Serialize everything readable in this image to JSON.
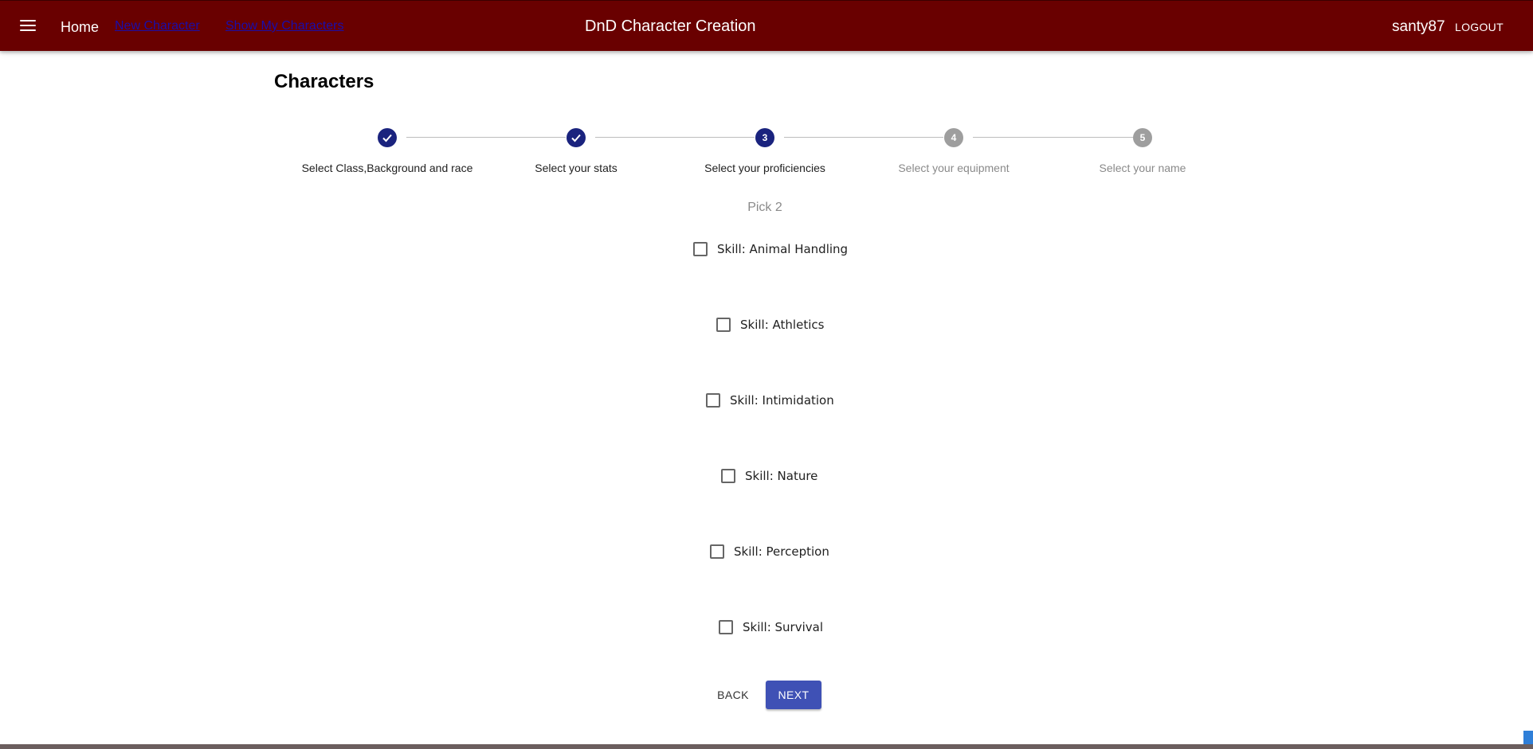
{
  "appbar": {
    "home_label": "Home",
    "new_character_label": "New Character",
    "show_characters_label": "Show My Characters",
    "title": "DnD Character Creation",
    "username": "santy87",
    "logout_label": "LOGOUT",
    "color": "#690000"
  },
  "page": {
    "title": "Characters"
  },
  "stepper": {
    "steps": [
      {
        "number": "1",
        "label": "Select Class,Background and race",
        "state": "done"
      },
      {
        "number": "2",
        "label": "Select your stats",
        "state": "done"
      },
      {
        "number": "3",
        "label": "Select your proficiencies",
        "state": "active"
      },
      {
        "number": "4",
        "label": "Select your equipment",
        "state": "pending"
      },
      {
        "number": "5",
        "label": "Select your name",
        "state": "pending"
      }
    ],
    "active_color": "#1a237e",
    "pending_color": "#9e9e9e"
  },
  "proficiencies": {
    "pick_label": "Pick 2",
    "skills": [
      {
        "label": "Skill: Animal Handling",
        "checked": false
      },
      {
        "label": "Skill: Athletics",
        "checked": false
      },
      {
        "label": "Skill: Intimidation",
        "checked": false
      },
      {
        "label": "Skill: Nature",
        "checked": false
      },
      {
        "label": "Skill: Perception",
        "checked": false
      },
      {
        "label": "Skill: Survival",
        "checked": false
      }
    ]
  },
  "actions": {
    "back_label": "BACK",
    "next_label": "NEXT",
    "next_color": "#3f51b5"
  }
}
